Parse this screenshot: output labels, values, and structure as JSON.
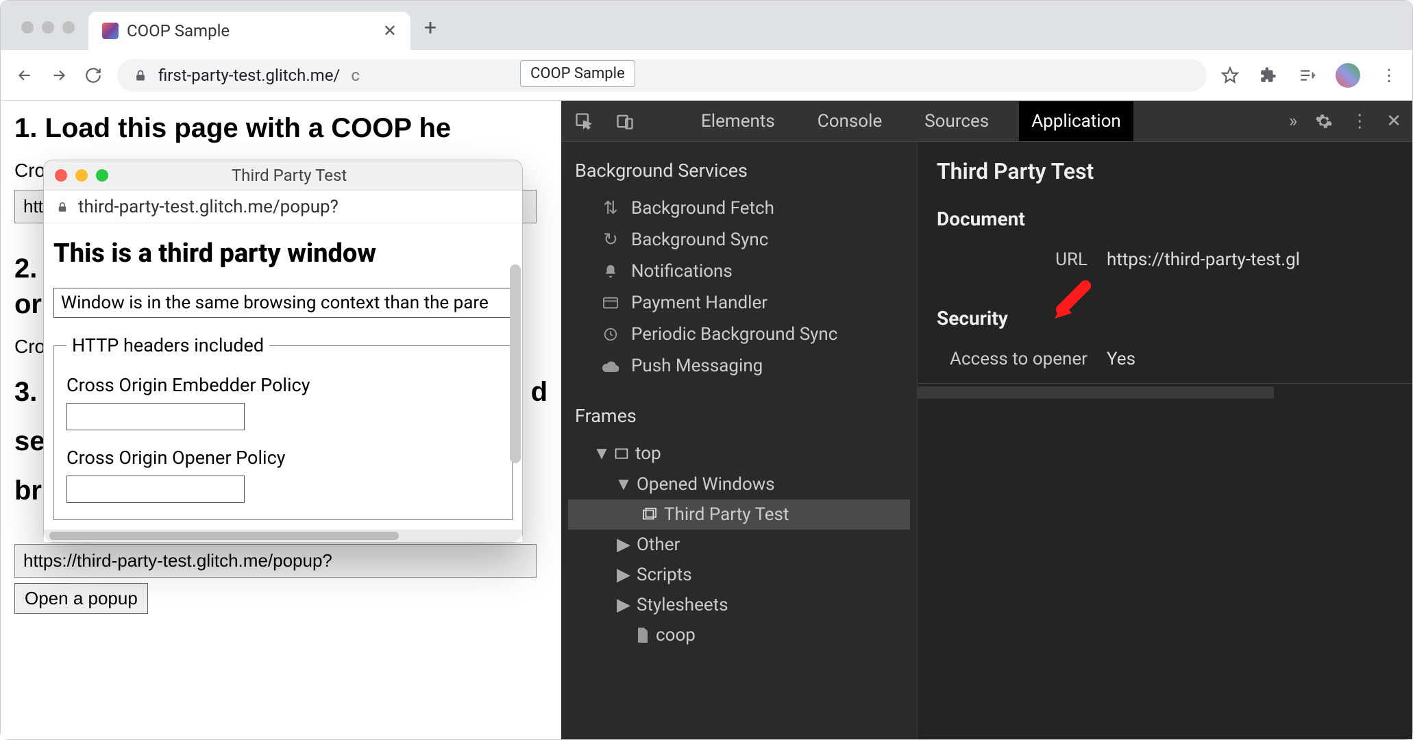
{
  "browser": {
    "tab_title": "COOP Sample",
    "url_host": "first-party-test.glitch.me/",
    "url_path_visible": "c",
    "url_tooltip": "COOP Sample"
  },
  "page": {
    "h1": "1. Load this page with a COOP he",
    "label_cro1": "Cro",
    "http_prefix": "http",
    "h2": "2.",
    "h2_b": "or",
    "label_cro2": "Cro",
    "h3": "3.",
    "h3_line2": "se",
    "h3_line3": "br",
    "h3_tail_d": "d",
    "popup_url_input": "https://third-party-test.glitch.me/popup?",
    "open_popup_btn": "Open a popup"
  },
  "popup": {
    "title": "Third Party Test",
    "url": "third-party-test.glitch.me/popup?",
    "heading": "This is a third party window",
    "context_text": "Window is in the same browsing context than the pare",
    "legend": "HTTP headers included",
    "coep_label": "Cross Origin Embedder Policy",
    "coop_label": "Cross Origin Opener Policy"
  },
  "devtools": {
    "tabs": {
      "elements": "Elements",
      "console": "Console",
      "sources": "Sources",
      "application": "Application"
    },
    "sidebar": {
      "bg_services": "Background Services",
      "items": {
        "bg_fetch": "Background Fetch",
        "bg_sync": "Background Sync",
        "notifications": "Notifications",
        "payment": "Payment Handler",
        "periodic": "Periodic Background Sync",
        "push": "Push Messaging"
      },
      "frames": "Frames",
      "tree": {
        "top": "top",
        "opened_windows": "Opened Windows",
        "third_party": "Third Party Test",
        "other": "Other",
        "scripts": "Scripts",
        "stylesheets": "Stylesheets",
        "coop": "coop"
      }
    },
    "main": {
      "title": "Third Party Test",
      "document_h": "Document",
      "url_label": "URL",
      "url_value": "https://third-party-test.gl",
      "security_h": "Security",
      "access_label": "Access to opener",
      "access_value": "Yes"
    }
  }
}
